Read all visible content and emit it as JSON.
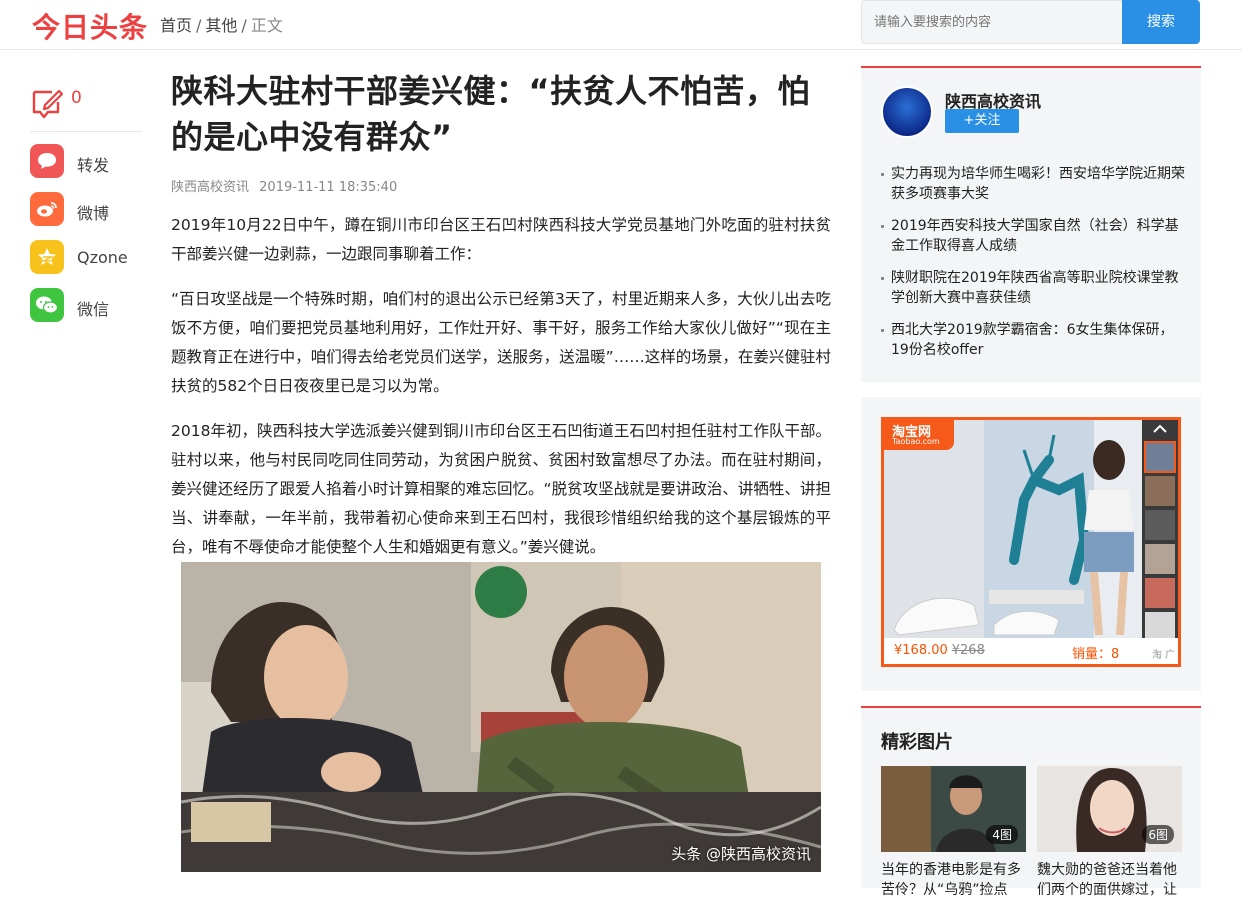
{
  "header": {
    "logo": "今日头条",
    "breadcrumb": [
      "首页",
      "其他",
      "正文"
    ],
    "search_placeholder": "请输入要搜索的内容",
    "search_button": "搜索"
  },
  "share": {
    "comment_count": "0",
    "items": [
      {
        "label": "转发",
        "icon": "repost-icon",
        "color": "#f05656"
      },
      {
        "label": "微博",
        "icon": "weibo-icon",
        "color": "#ff6a3d"
      },
      {
        "label": "Qzone",
        "icon": "qzone-icon",
        "color": "#f8c21c"
      },
      {
        "label": "微信",
        "icon": "wechat-icon",
        "color": "#3fc540"
      }
    ]
  },
  "article": {
    "title": "陕科大驻村干部姜兴健：“扶贫人不怕苦，怕的是心中没有群众”",
    "source": "陕西高校资讯",
    "time": "2019-11-11 18:35:40",
    "paragraphs": [
      "2019年10月22日中午，蹲在铜川市印台区王石凹村陕西科技大学党员基地门外吃面的驻村扶贫干部姜兴健一边剥蒜，一边跟同事聊着工作：",
      "“百日攻坚战是一个特殊时期，咱们村的退出公示已经第3天了，村里近期来人多，大伙儿出去吃饭不方便，咱们要把党员基地利用好，工作灶开好、事干好，服务工作给大家伙儿做好”“现在主题教育正在进行中，咱们得去给老党员们送学，送服务，送温暖”……这样的场景，在姜兴健驻村扶贫的582个日日夜夜里已是习以为常。",
      "2018年初，陕西科技大学选派姜兴健到铜川市印台区王石凹街道王石凹村担任驻村工作队干部。驻村以来，他与村民同吃同住同劳动，为贫困户脱贫、贫困村致富想尽了办法。而在驻村期间，姜兴健还经历了跟爱人掐着小时计算相聚的难忘回忆。“脱贫攻坚战就是要讲政治、讲牺牲、讲担当、讲奉献，一年半前，我带着初心使命来到王石凹村，我很珍惜组织给我的这个基层锻炼的平台，唯有不辱使命才能使整个人生和婚姻更有意义。”姜兴健说。"
    ],
    "photo_watermark": "头条 @陕西高校资讯"
  },
  "sidebar": {
    "author_name": "陕西高校资讯",
    "follow_label": "+关注",
    "news": [
      "实力再现为培华师生喝彩！西安培华学院近期荣获多项赛事大奖",
      "2019年西安科技大学国家自然（社会）科学基金工作取得喜人成绩",
      "陕财职院在2019年陕西省高等职业院校课堂教学创新大赛中喜获佳绩",
      "西北大学2019款学霸宿舍：6女生集体保研，19份名校offer"
    ],
    "ad": {
      "brand": "淘宝网",
      "brand_sub": "Taobao.com",
      "price": "¥168.00",
      "old_price": "¥268",
      "sales": "销量：8",
      "mark": "淘 广告"
    },
    "pictures": {
      "heading": "精彩图片",
      "items": [
        {
          "badge": "4图",
          "caption": "当年的香港电影是有多苦伶？从“乌鸦”捡点"
        },
        {
          "badge": "6图",
          "caption": "魏大勋的爸爸还当着他们两个的面供嫁过，让"
        }
      ]
    }
  }
}
